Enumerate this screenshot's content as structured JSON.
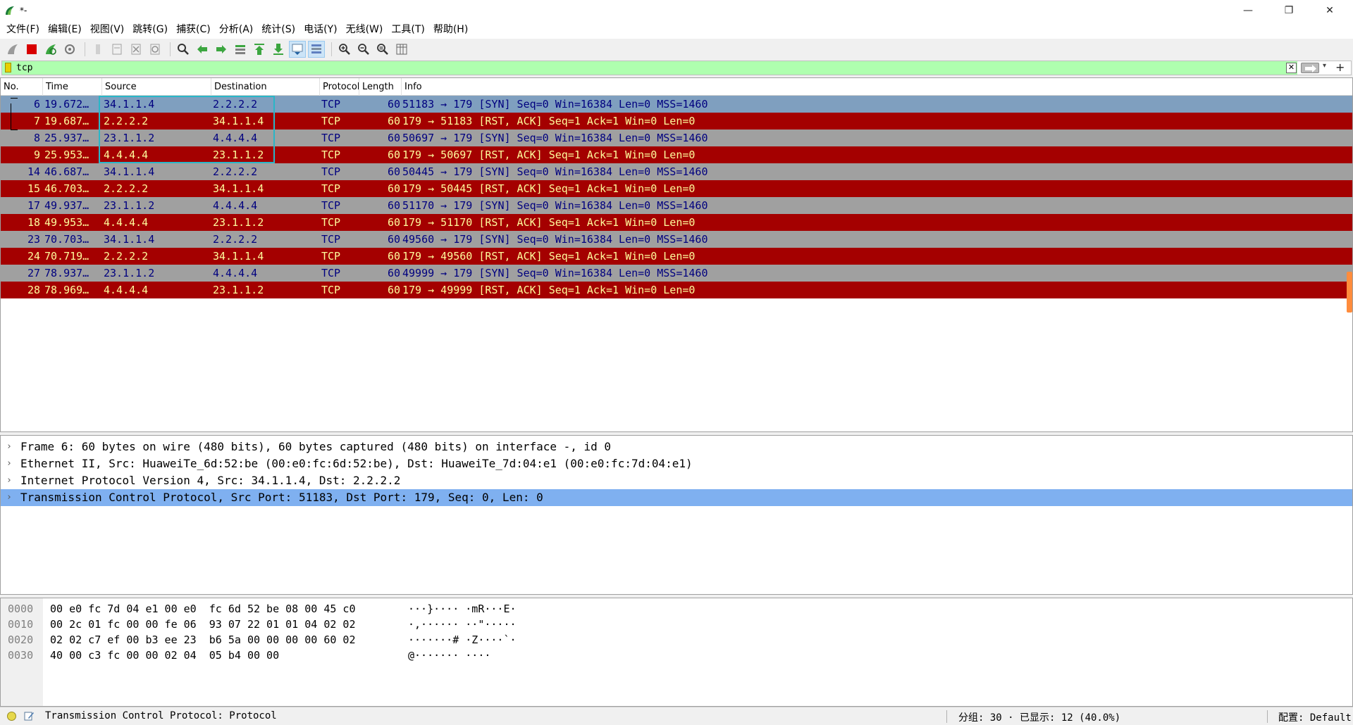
{
  "window": {
    "title": "*-",
    "minimize": "—",
    "restore": "❐",
    "close": "✕"
  },
  "menu": [
    "文件(F)",
    "编辑(E)",
    "视图(V)",
    "跳转(G)",
    "捕获(C)",
    "分析(A)",
    "统计(S)",
    "电话(Y)",
    "无线(W)",
    "工具(T)",
    "帮助(H)"
  ],
  "filter": {
    "value": "tcp",
    "clear": "✕",
    "dropdown": "▾",
    "add": "+"
  },
  "columns": [
    "No.",
    "Time",
    "Source",
    "Destination",
    "Protocol",
    "Length",
    "Info"
  ],
  "packets": [
    {
      "no": "6",
      "time": "19.672…",
      "src": "34.1.1.4",
      "dst": "2.2.2.2",
      "proto": "TCP",
      "len": "60",
      "info": "51183 → 179 [SYN] Seq=0 Win=16384 Len=0 MSS=1460",
      "kind": "sel"
    },
    {
      "no": "7",
      "time": "19.687…",
      "src": "2.2.2.2",
      "dst": "34.1.1.4",
      "proto": "TCP",
      "len": "60",
      "info": "179 → 51183 [RST, ACK] Seq=1 Ack=1 Win=0 Len=0",
      "kind": "rst"
    },
    {
      "no": "8",
      "time": "25.937…",
      "src": "23.1.1.2",
      "dst": "4.4.4.4",
      "proto": "TCP",
      "len": "60",
      "info": "50697 → 179 [SYN] Seq=0 Win=16384 Len=0 MSS=1460",
      "kind": "syn"
    },
    {
      "no": "9",
      "time": "25.953…",
      "src": "4.4.4.4",
      "dst": "23.1.1.2",
      "proto": "TCP",
      "len": "60",
      "info": "179 → 50697 [RST, ACK] Seq=1 Ack=1 Win=0 Len=0",
      "kind": "rst"
    },
    {
      "no": "14",
      "time": "46.687…",
      "src": "34.1.1.4",
      "dst": "2.2.2.2",
      "proto": "TCP",
      "len": "60",
      "info": "50445 → 179 [SYN] Seq=0 Win=16384 Len=0 MSS=1460",
      "kind": "syn"
    },
    {
      "no": "15",
      "time": "46.703…",
      "src": "2.2.2.2",
      "dst": "34.1.1.4",
      "proto": "TCP",
      "len": "60",
      "info": "179 → 50445 [RST, ACK] Seq=1 Ack=1 Win=0 Len=0",
      "kind": "rst"
    },
    {
      "no": "17",
      "time": "49.937…",
      "src": "23.1.1.2",
      "dst": "4.4.4.4",
      "proto": "TCP",
      "len": "60",
      "info": "51170 → 179 [SYN] Seq=0 Win=16384 Len=0 MSS=1460",
      "kind": "syn"
    },
    {
      "no": "18",
      "time": "49.953…",
      "src": "4.4.4.4",
      "dst": "23.1.1.2",
      "proto": "TCP",
      "len": "60",
      "info": "179 → 51170 [RST, ACK] Seq=1 Ack=1 Win=0 Len=0",
      "kind": "rst"
    },
    {
      "no": "23",
      "time": "70.703…",
      "src": "34.1.1.4",
      "dst": "2.2.2.2",
      "proto": "TCP",
      "len": "60",
      "info": "49560 → 179 [SYN] Seq=0 Win=16384 Len=0 MSS=1460",
      "kind": "syn"
    },
    {
      "no": "24",
      "time": "70.719…",
      "src": "2.2.2.2",
      "dst": "34.1.1.4",
      "proto": "TCP",
      "len": "60",
      "info": "179 → 49560 [RST, ACK] Seq=1 Ack=1 Win=0 Len=0",
      "kind": "rst"
    },
    {
      "no": "27",
      "time": "78.937…",
      "src": "23.1.1.2",
      "dst": "4.4.4.4",
      "proto": "TCP",
      "len": "60",
      "info": "49999 → 179 [SYN] Seq=0 Win=16384 Len=0 MSS=1460",
      "kind": "syn"
    },
    {
      "no": "28",
      "time": "78.969…",
      "src": "4.4.4.4",
      "dst": "23.1.1.2",
      "proto": "TCP",
      "len": "60",
      "info": "179 → 49999 [RST, ACK] Seq=1 Ack=1 Win=0 Len=0",
      "kind": "rst"
    }
  ],
  "details": [
    {
      "text": "Frame 6: 60 bytes on wire (480 bits), 60 bytes captured (480 bits) on interface -, id 0",
      "selected": false
    },
    {
      "text": "Ethernet II, Src: HuaweiTe_6d:52:be (00:e0:fc:6d:52:be), Dst: HuaweiTe_7d:04:e1 (00:e0:fc:7d:04:e1)",
      "selected": false
    },
    {
      "text": "Internet Protocol Version 4, Src: 34.1.1.4, Dst: 2.2.2.2",
      "selected": false
    },
    {
      "text": "Transmission Control Protocol, Src Port: 51183, Dst Port: 179, Seq: 0, Len: 0",
      "selected": true
    }
  ],
  "detail_chevron": "›",
  "bytes": [
    {
      "offset": "0000",
      "hex": "00 e0 fc 7d 04 e1 00 e0  fc 6d 52 be 08 00 45 c0",
      "ascii": "···}···· ·mR···E·"
    },
    {
      "offset": "0010",
      "hex": "00 2c 01 fc 00 00 fe 06  93 07 22 01 01 04 02 02",
      "ascii": "·,······ ··\"·····"
    },
    {
      "offset": "0020",
      "hex": "02 02 c7 ef 00 b3 ee 23  b6 5a 00 00 00 00 60 02",
      "ascii": "·······# ·Z····`·"
    },
    {
      "offset": "0030",
      "hex": "40 00 c3 fc 00 00 02 04  05 b4 00 00",
      "ascii": "@······· ····"
    }
  ],
  "status": {
    "text": "Transmission Control Protocol: Protocol",
    "packets": "分组: 30 · 已显示: 12 (40.0%)",
    "profile": "配置: Default"
  },
  "colors": {
    "syn_bg": "#a0a0a0",
    "rst_bg": "#a40000",
    "rst_fg": "#fffc9c",
    "filter_ok": "#afffaf"
  }
}
